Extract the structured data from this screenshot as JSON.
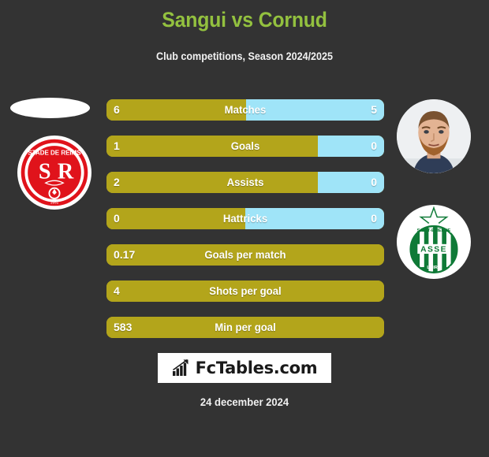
{
  "header": {
    "title": "Sangui vs Cornud",
    "subtitle": "Club competitions, Season 2024/2025"
  },
  "colors": {
    "background": "#333333",
    "title_green": "#93c13f",
    "home_gold": "#b3a51b",
    "away_blue": "#9fe4f8",
    "text_white": "#ffffff"
  },
  "home": {
    "player_name": "Sangui",
    "player_photo": "missing-photo-placeholder",
    "club_crest": "stade-de-reims-crest",
    "crest_text_top": "STADE DE REIMS",
    "crest_monogram": "S R"
  },
  "away": {
    "player_name": "Cornud",
    "player_photo": "player-portrait-photo",
    "club_crest": "saint-etienne-asse-crest",
    "crest_text_top": "SAINT-ETIENNE",
    "crest_monogram": "ASSE",
    "crest_text_bottom": "LOIRE"
  },
  "stats": [
    {
      "label": "Matches",
      "home": "6",
      "away": "5",
      "home_pct": 50.3,
      "away_pct": 49.7,
      "split": true
    },
    {
      "label": "Goals",
      "home": "1",
      "away": "0",
      "home_pct": 76.0,
      "away_pct": 24.0,
      "split": true
    },
    {
      "label": "Assists",
      "home": "2",
      "away": "0",
      "home_pct": 76.0,
      "away_pct": 24.0,
      "split": true
    },
    {
      "label": "Hattricks",
      "home": "0",
      "away": "0",
      "home_pct": 50.0,
      "away_pct": 50.0,
      "split": true
    },
    {
      "label": "Goals per match",
      "home": "0.17",
      "away": "",
      "home_pct": 100,
      "away_pct": 0,
      "split": false
    },
    {
      "label": "Shots per goal",
      "home": "4",
      "away": "",
      "home_pct": 100,
      "away_pct": 0,
      "split": false
    },
    {
      "label": "Min per goal",
      "home": "583",
      "away": "",
      "home_pct": 100,
      "away_pct": 0,
      "split": false
    }
  ],
  "footer": {
    "logo_text": "FcTables.com",
    "logo_icon": "bar-chart-growth-icon",
    "date": "24 december 2024"
  }
}
